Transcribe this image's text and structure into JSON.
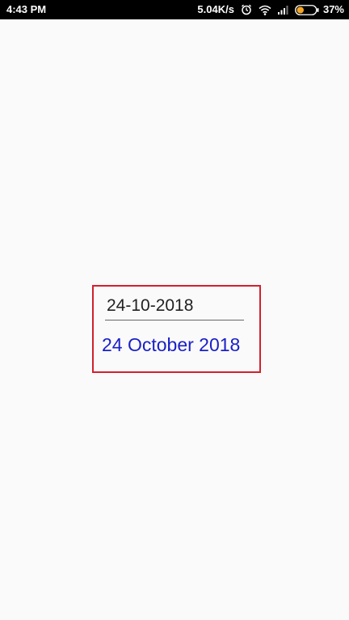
{
  "status_bar": {
    "time": "4:43 PM",
    "network_speed": "5.04K/s",
    "icons": [
      "alarm-icon",
      "wifi-icon",
      "signal-icon",
      "battery-icon"
    ],
    "battery_percent": "37%",
    "battery_level": 0.37
  },
  "main": {
    "date_input_value": "24-10-2018",
    "formatted_date": "24 October 2018"
  },
  "colors": {
    "status_bar_bg": "#000000",
    "page_bg": "#fafafa",
    "box_border": "#d3202e",
    "formatted_text": "#1a20c8",
    "battery_fill": "#f5a623"
  }
}
